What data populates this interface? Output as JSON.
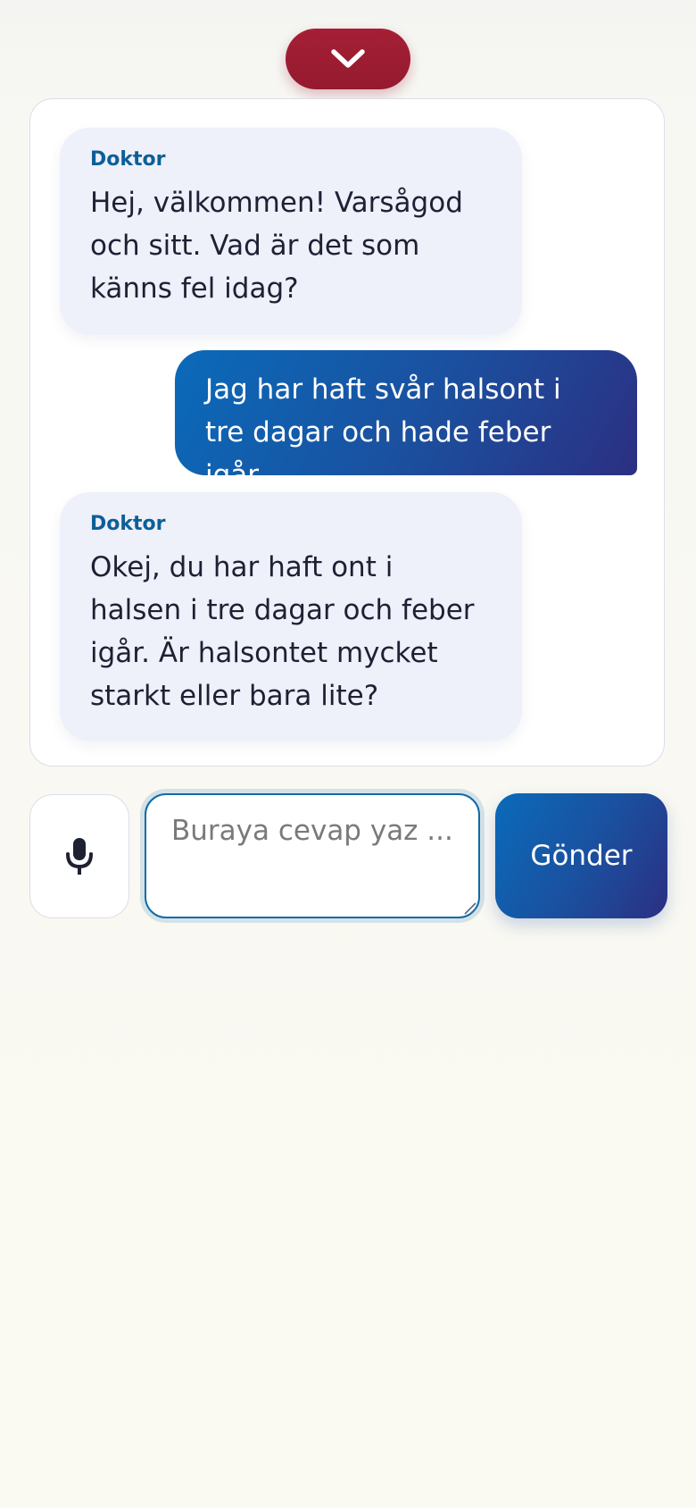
{
  "header": {
    "collapse_icon": "chevron-down-icon",
    "collapse_color": "#a51f35"
  },
  "chat": {
    "messages": [
      {
        "role": "doctor",
        "sender": "Doktor",
        "text": "Hej, välkommen! Varsågod och sitt. Vad är det som känns fel idag?"
      },
      {
        "role": "patient",
        "text": "Jag har haft svår halsont i tre dagar och hade feber igår."
      },
      {
        "role": "doctor",
        "sender": "Doktor",
        "text": "Okej, du har haft ont i halsen i tre dagar och feber igår. Är halsontet mycket starkt eller bara lite?"
      }
    ]
  },
  "composer": {
    "mic_icon": "microphone-icon",
    "input_value": "",
    "input_placeholder": "Buraya cevap yaz ...",
    "send_label": "Gönder",
    "accent_color": "#0a6bba"
  }
}
